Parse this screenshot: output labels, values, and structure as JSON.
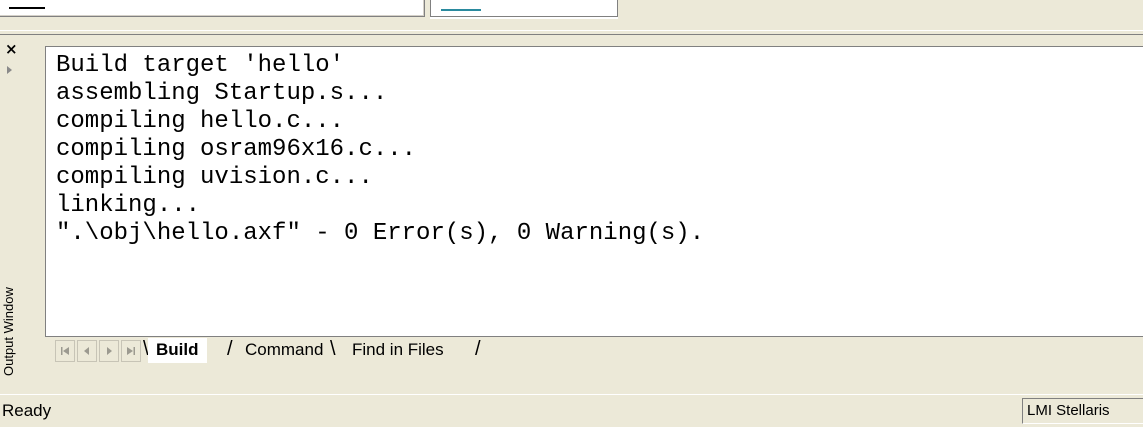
{
  "output_window": {
    "title": "Output Window",
    "lines": [
      "Build target 'hello'",
      "assembling Startup.s...",
      "compiling hello.c...",
      "compiling osram96x16.c...",
      "compiling uvision.c...",
      "linking...",
      "\".\\obj\\hello.axf\" - 0 Error(s), 0 Warning(s)."
    ],
    "tabs": [
      "Build",
      "Command",
      "Find in Files"
    ],
    "active_tab": "Build"
  },
  "status_bar": {
    "message": "Ready",
    "target": "LMI Stellaris"
  }
}
